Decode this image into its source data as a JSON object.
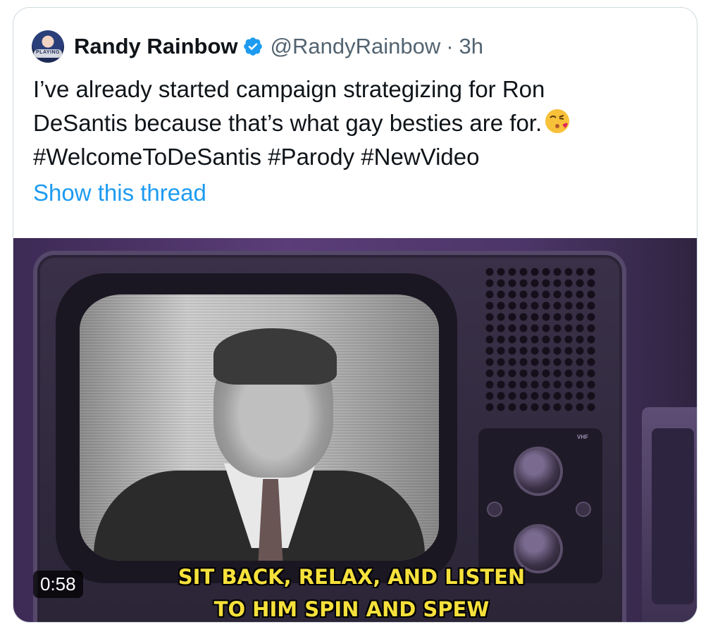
{
  "tweet": {
    "author_name": "Randy Rainbow",
    "author_handle": "@RandyRainbow",
    "separator": "·",
    "time_ago": "3h",
    "avatar_text": "PLAYING",
    "text_lines": [
      "I’ve already started campaign strategizing for Ron",
      "DeSantis because that’s what gay besties are for.",
      "#WelcomeToDeSantis #Parody #NewVideo"
    ],
    "emoji": "face-blowing-a-kiss",
    "show_thread_label": "Show this thread"
  },
  "media": {
    "duration": "0:58",
    "subtitle_lines": [
      "SIT BACK, RELAX, AND LISTEN",
      "TO HIM SPIN AND SPEW"
    ],
    "tv_label": "VHF"
  },
  "colors": {
    "link": "#1d9bf0",
    "secondary_text": "#536471",
    "verified": "#1d9bf0",
    "subtitle": "#f6e13c"
  }
}
